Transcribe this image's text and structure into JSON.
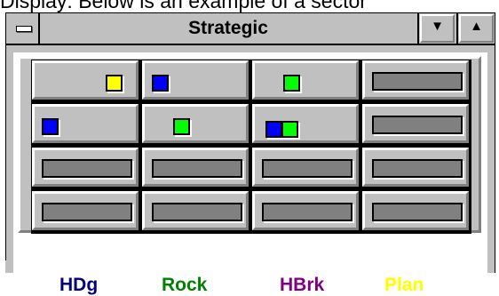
{
  "background_text": "Display:  Below is an example of a sector",
  "window": {
    "title": "Strategic",
    "minimize_glyph": "▼",
    "maximize_glyph": "▲"
  },
  "colors": {
    "yellow": "#ffff00",
    "blue": "#0000ff",
    "green": "#00ff00",
    "navy": "#000080",
    "dark_green": "#008000",
    "purple": "#800080"
  },
  "grid": {
    "rows": [
      [
        {
          "markers": [
            "yellow"
          ]
        },
        {
          "markers": [
            "blue"
          ]
        },
        {
          "markers": [
            "green"
          ]
        },
        {
          "markers": []
        }
      ],
      [
        {
          "markers": [
            "blue"
          ]
        },
        {
          "markers": [
            "green"
          ]
        },
        {
          "markers": [
            "blue",
            "green"
          ]
        },
        {
          "markers": []
        }
      ],
      [
        {
          "markers": []
        },
        {
          "markers": []
        },
        {
          "markers": []
        },
        {
          "markers": []
        }
      ],
      [
        {
          "markers": []
        },
        {
          "markers": []
        },
        {
          "markers": []
        },
        {
          "markers": []
        }
      ]
    ]
  },
  "legend": [
    {
      "label": "HDg",
      "color": "#000080"
    },
    {
      "label": "Rock",
      "color": "#008000"
    },
    {
      "label": "HBrk",
      "color": "#800080"
    },
    {
      "label": "Plan",
      "color": "#ffff00"
    }
  ]
}
